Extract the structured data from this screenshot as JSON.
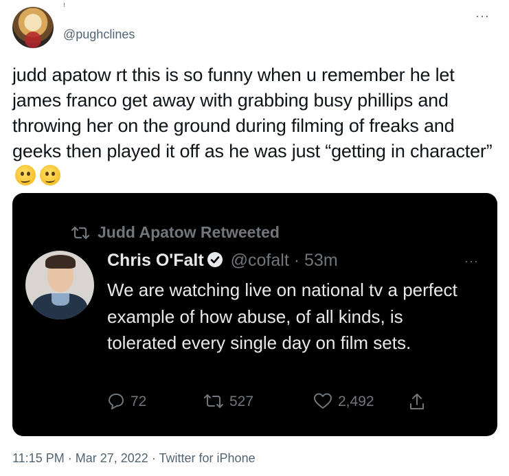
{
  "author": {
    "display_name": "ꜝ",
    "handle": "@pughclines"
  },
  "tweet": {
    "text": "judd apatow rt this is so funny when u remember he let james franco get away with grabbing busy phillips and throwing her on the ground during filming of freaks and geeks then played it off as he was just “getting in character”",
    "emoji": [
      "woozy-face",
      "woozy-face"
    ]
  },
  "embedded": {
    "retweet_label": "Judd Apatow Retweeted",
    "name": "Chris O'Falt",
    "handle": "@cofalt",
    "separator": "·",
    "time": "53m",
    "text": "We are watching live on national tv a perfect example of how abuse, of all kinds, is tolerated every single day on film sets.",
    "replies": "72",
    "retweets": "527",
    "likes": "2,492"
  },
  "footer": {
    "time": "11:15 PM",
    "sep1": "·",
    "date": "Mar 27, 2022",
    "sep2": "·",
    "source": "Twitter for iPhone"
  },
  "colors": {
    "text_primary": "#0f1419",
    "text_secondary": "#536471",
    "embed_bg": "#000000",
    "embed_text": "#e7e9ea",
    "embed_muted": "#71767b"
  }
}
